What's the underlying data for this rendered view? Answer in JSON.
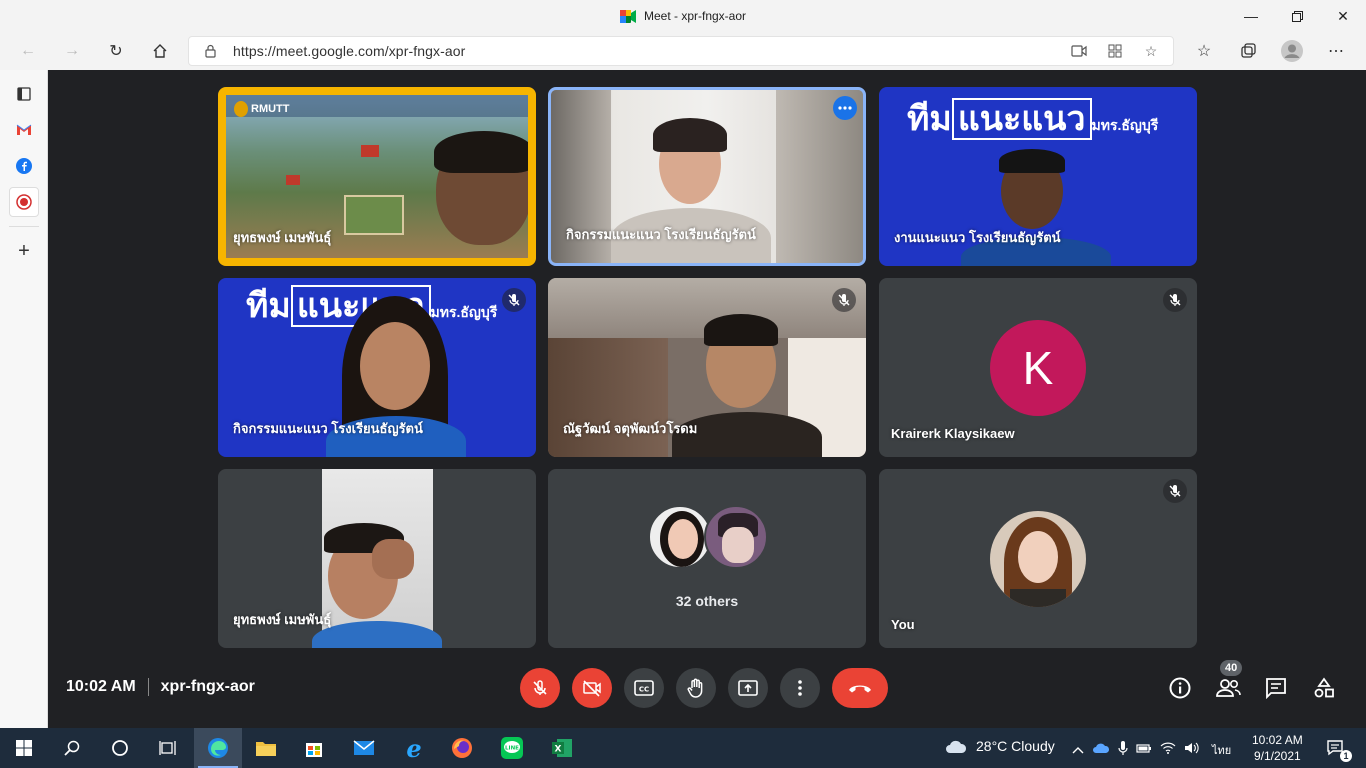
{
  "window": {
    "title": "Meet - xpr-fngx-aor"
  },
  "browser": {
    "url": "https://meet.google.com/xpr-fngx-aor"
  },
  "tiles": [
    {
      "name": "ยุทธพงษ์ เมษพันธุ์",
      "logo_text": "RMUTT"
    },
    {
      "name": "กิจกรรมแนะแนว โรงเรียนธัญรัตน์"
    },
    {
      "name": "งานแนะแนว โรงเรียนธัญรัตน์",
      "banner_a": "ทีม",
      "banner_b": "แนะแนว",
      "banner_c": "มทร.ธัญบุรี"
    },
    {
      "name": "กิจกรรมแนะแนว โรงเรียนธัญรัตน์",
      "banner_a": "ทีม",
      "banner_b": "แนะแนว",
      "banner_c": "มทร.ธัญบุรี"
    },
    {
      "name": "ณัฐวัฒน์ จตุพัฒน์วโรดม"
    },
    {
      "name": "Krairerk Klaysikaew",
      "initial": "K",
      "avatar_color": "#c2185b"
    },
    {
      "name": "ยุทธพงษ์ เมษพันธุ์"
    },
    {
      "name": "32 others"
    },
    {
      "name": "You"
    }
  ],
  "bottom": {
    "time": "10:02 AM",
    "meeting_code": "xpr-fngx-aor",
    "participants_count": "40"
  },
  "taskbar": {
    "weather": "28°C  Cloudy",
    "lang": "ไทย",
    "time": "10:02 AM",
    "date": "9/1/2021",
    "notif": "1"
  }
}
